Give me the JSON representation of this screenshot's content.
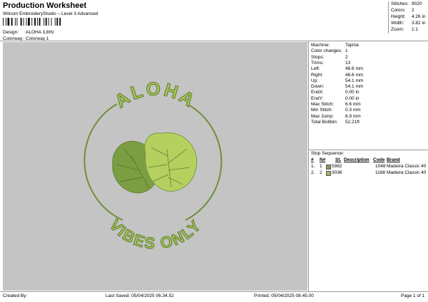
{
  "header": {
    "title": "Production Worksheet",
    "subtitle": "Wilcom EmbroideryStudio – Level 3 Advanced",
    "design_label": "Design:",
    "design_value": "ALOHA 3,8IN",
    "colorway_label": "Colorway:",
    "colorway_value": "Colorway 1"
  },
  "summary": [
    {
      "label": "Stitches:",
      "value": "9020"
    },
    {
      "label": "Colors:",
      "value": "2"
    },
    {
      "label": "Height:",
      "value": "4.26 in"
    },
    {
      "label": "Width:",
      "value": "3.82 in"
    },
    {
      "label": "Zoom:",
      "value": "1:1"
    }
  ],
  "machine_info": [
    {
      "label": "Machine:",
      "value": "Tajima"
    },
    {
      "label": "Color changes:",
      "value": "1"
    },
    {
      "label": "Stops:",
      "value": "2"
    },
    {
      "label": "Trims:",
      "value": "13"
    },
    {
      "label": "Left:",
      "value": "48.6 mm"
    },
    {
      "label": "Right:",
      "value": "48.6 mm"
    },
    {
      "label": "Up:",
      "value": "54.1 mm"
    },
    {
      "label": "Down:",
      "value": "54.1 mm"
    },
    {
      "label": "EndX:",
      "value": "0.00 in"
    },
    {
      "label": "EndY:",
      "value": "0.00 in"
    },
    {
      "label": "Max Stitch:",
      "value": "6.6 mm"
    },
    {
      "label": "Min Stitch:",
      "value": "0.3 mm"
    },
    {
      "label": "Max Jump:",
      "value": "6.9 mm"
    },
    {
      "label": "Total Bobbin:",
      "value": "52.21ft"
    }
  ],
  "stop_sequence": {
    "title": "Stop Sequence:",
    "headers": {
      "num": "#",
      "n": "N#",
      "st": "St.",
      "desc": "Description",
      "code": "Code",
      "brand": "Brand"
    },
    "rows": [
      {
        "num": "1.",
        "n": "1",
        "color": "#8a9a52",
        "desc": "5982",
        "st": "1048",
        "brand": "Madeira Classic 40"
      },
      {
        "num": "2.",
        "n": "2",
        "color": "#a7b46a",
        "desc": "3036",
        "st": "1168",
        "brand": "Madeira Classic 40"
      }
    ]
  },
  "design": {
    "top_text": "ALOHA",
    "bottom_text": "VIBES ONLY",
    "thread_dark": "#6a8a38",
    "thread_light": "#a5c455"
  },
  "footer": {
    "created_by": "Created By:",
    "last_saved": "Last Saved: 05/04/2025 06.34.52",
    "printed": "Printed: 05/04/2025 08.45.00",
    "page": "Page 1 of 1"
  }
}
